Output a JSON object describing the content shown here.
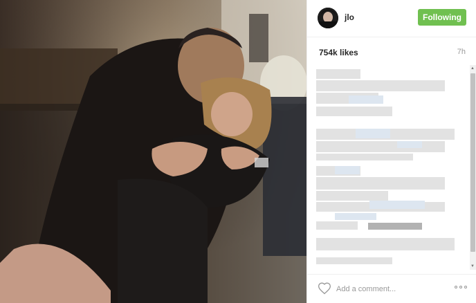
{
  "header": {
    "username": "jlo",
    "follow_label": "Following"
  },
  "stats": {
    "likes": "754k likes",
    "time": "7h"
  },
  "comment_box": {
    "placeholder": "Add a comment..."
  },
  "colors": {
    "follow": "#70c050",
    "text": "#262626",
    "muted": "#999999"
  },
  "icons": {
    "like": "heart-icon",
    "more": "more-options-icon"
  }
}
